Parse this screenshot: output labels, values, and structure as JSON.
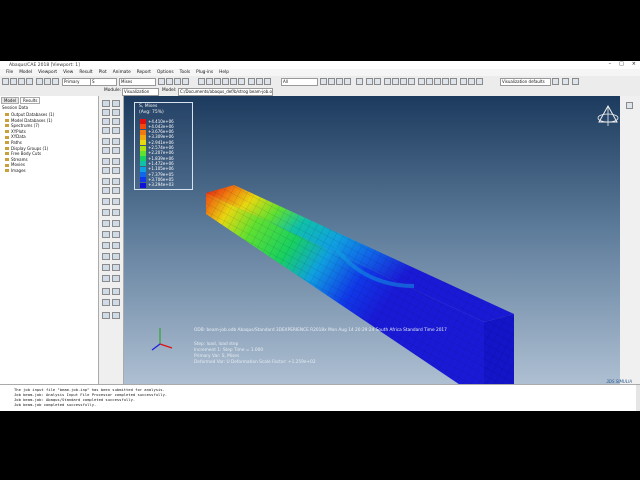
{
  "window": {
    "title": "Abaqus/CAE 2018 [Viewport: 1]"
  },
  "menu": [
    "File",
    "Model",
    "Viewport",
    "View",
    "Result",
    "Plot",
    "Animate",
    "Report",
    "Options",
    "Tools",
    "Plug-ins",
    "Help"
  ],
  "toolbar": {
    "render_select": "Primary",
    "field_select": "S",
    "field_component": "Mises",
    "all_select": "All",
    "vis_defaults": "Visualization defaults"
  },
  "context": {
    "module_label": "Module:",
    "module_value": "Visualization",
    "model_label": "Model:",
    "model_value": "C:/Documents/abaqus_def/b/strog beam-job.odb"
  },
  "tree": {
    "tabs": [
      "Model",
      "Results"
    ],
    "session_label": "Session Data",
    "items": [
      "Output Databases (1)",
      "Model Databases (1)",
      "Spectrums (7)",
      "XYPlots",
      "XYData",
      "Paths",
      "Display Groups (1)",
      "Free Body Cuts",
      "Streams",
      "Movies",
      "Images"
    ]
  },
  "legend": {
    "title": "S, Mises",
    "subtitle": "(Avg: 75%)",
    "values": [
      "+4.410e+06",
      "+4.043e+06",
      "+3.676e+06",
      "+3.309e+06",
      "+2.941e+06",
      "+2.574e+06",
      "+2.207e+06",
      "+1.839e+06",
      "+1.472e+06",
      "+1.105e+06",
      "+7.379e+05",
      "+3.706e+05",
      "+3.294e+03"
    ],
    "colors": [
      "#e01010",
      "#f04a10",
      "#f07a10",
      "#f0a810",
      "#e8d810",
      "#b0e010",
      "#60e030",
      "#18d060",
      "#10c0a8",
      "#10a0e0",
      "#1068e8",
      "#1038e8",
      "#1010d8"
    ]
  },
  "viewport_info": {
    "odb_line": "ODB: beam-job.odb    Abaqus/Standard 3DEXPERIENCE R2018x    Mon Aug 14 20:29:24 South Africa Standard Time 2017",
    "step_line": "Step: load, load step",
    "increment_line": "Increment    1: Step Time =    1.000",
    "primary_line": "Primary Var: S, Mises",
    "deformed_line": "Deformed Var: U   Deformation Scale Factor: +1.259e+02"
  },
  "messages": [
    "The job input file \"beam-job.inp\" has been submitted for analysis.",
    "Job beam-job: Analysis Input File Processor completed successfully.",
    "Job beam-job: Abaqus/Standard completed successfully.",
    "Job beam-job completed successfully."
  ],
  "brand": {
    "text": "3DS SIMULIA"
  },
  "colors": {
    "viewport_top": "#1c3a5d",
    "viewport_bottom": "#aebfd2",
    "beam_blue": "#1a1ad6"
  }
}
